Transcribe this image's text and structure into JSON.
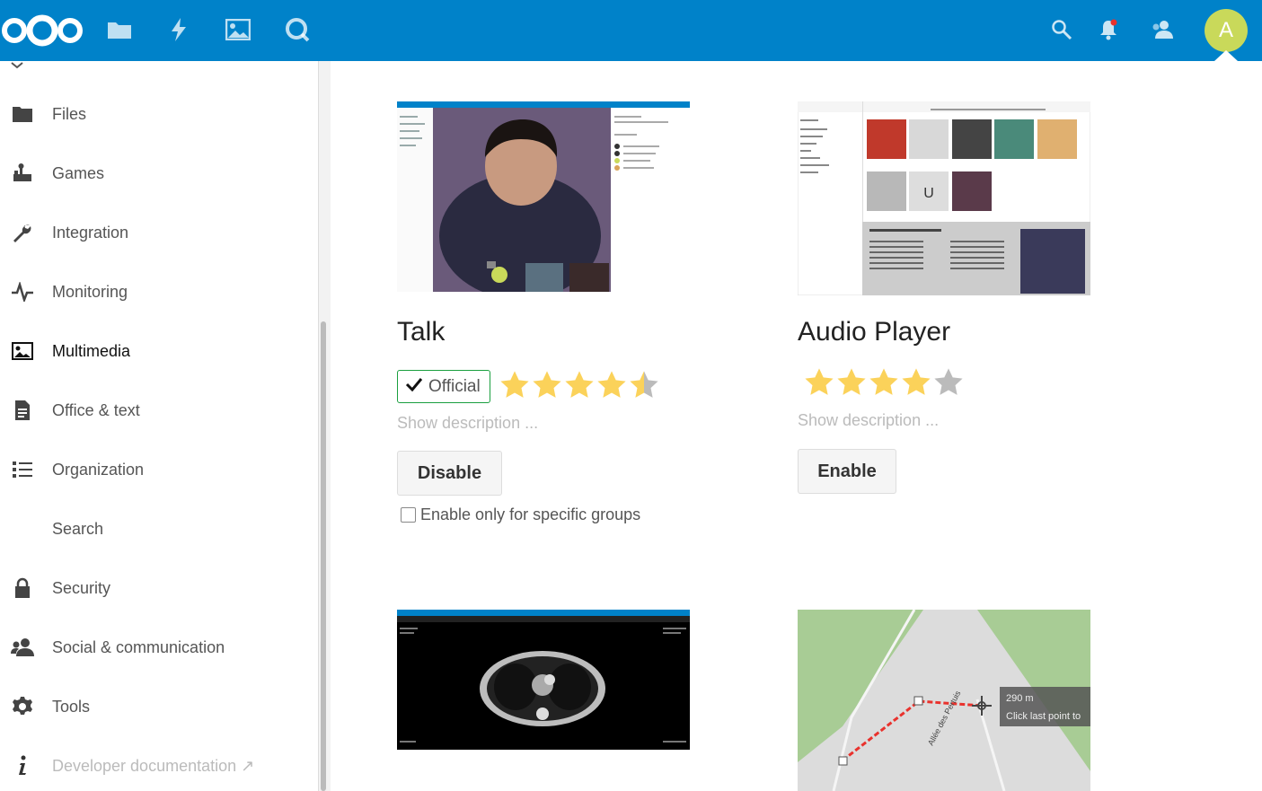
{
  "header": {
    "logo": "nextcloud-logo",
    "apps": [
      "files-icon",
      "activity-icon",
      "gallery-icon",
      "talk-icon"
    ],
    "right_icons": [
      "search-icon",
      "notifications-icon",
      "contacts-icon"
    ],
    "avatar_letter": "A",
    "colors": {
      "bar": "#0082c9",
      "avatar": "#c9d95a",
      "notification_dot": "#e9322d"
    }
  },
  "sidebar": {
    "items": [
      {
        "label": "Files",
        "icon": "folder-icon"
      },
      {
        "label": "Games",
        "icon": "games-icon"
      },
      {
        "label": "Integration",
        "icon": "wrench-icon"
      },
      {
        "label": "Monitoring",
        "icon": "pulse-icon"
      },
      {
        "label": "Multimedia",
        "icon": "image-icon",
        "active": true
      },
      {
        "label": "Office & text",
        "icon": "document-icon"
      },
      {
        "label": "Organization",
        "icon": "list-icon"
      },
      {
        "label": "Search",
        "icon": ""
      },
      {
        "label": "Security",
        "icon": "lock-icon"
      },
      {
        "label": "Social & communication",
        "icon": "people-icon"
      },
      {
        "label": "Tools",
        "icon": "gear-icon"
      },
      {
        "label": "Developer documentation ↗",
        "icon": "info-icon"
      }
    ]
  },
  "apps": [
    {
      "name": "Talk",
      "badge": "Official",
      "rating": 4.5,
      "show_description": "Show description ...",
      "button": "Disable",
      "group_checkbox": "Enable only for specific groups",
      "group_checkbox_checked": false
    },
    {
      "name": "Audio Player",
      "rating": 4,
      "show_description": "Show description ...",
      "button": "Enable"
    }
  ],
  "map_preview": {
    "distance": "290 m",
    "hint": "Click last point to",
    "street": "Allée des Pertuis"
  },
  "colors": {
    "star_filled": "#fbd25a",
    "star_empty": "#bbbbbb",
    "official_border": "#1a9f3f"
  }
}
